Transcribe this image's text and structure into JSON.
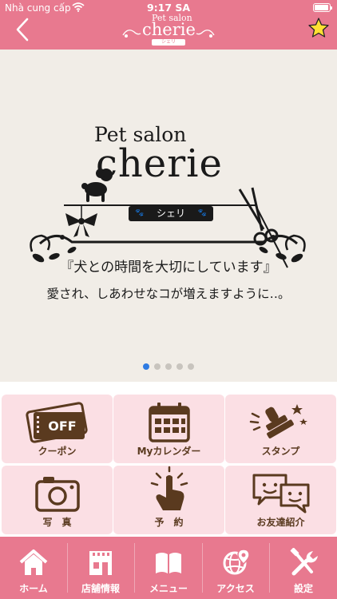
{
  "status_bar": {
    "carrier": "Nhà cung cấp",
    "time": "9:17 SA",
    "battery_level": 0.95
  },
  "header": {
    "back_icon": "chevron-left-icon",
    "logo_line1": "Pet salon",
    "logo_line2": "cherie",
    "logo_line3": "シェリ",
    "favorite_icon": "star-icon",
    "star_color": "#ffe033"
  },
  "hero": {
    "logo_pet": "Pet salon",
    "logo_cherie": "cherie",
    "logo_sheri": "シェリ",
    "tagline": "『犬との時間を大切にしています』",
    "subtagline": "愛され、しあわせなコが増えますように‥。",
    "slide_count": 5,
    "active_slide": 1
  },
  "menu": [
    {
      "label": "クーポン",
      "icon": "coupon-off-icon"
    },
    {
      "label": "Myカレンダー",
      "icon": "calendar-icon"
    },
    {
      "label": "スタンプ",
      "icon": "stamp-icon"
    },
    {
      "label": "写　真",
      "icon": "camera-icon"
    },
    {
      "label": "予　約",
      "icon": "tap-hand-icon"
    },
    {
      "label": "お友達紹介",
      "icon": "chat-faces-icon"
    }
  ],
  "coupon_icon_text": "OFF",
  "tabbar": [
    {
      "label": "ホーム",
      "icon": "home-icon"
    },
    {
      "label": "店舗情報",
      "icon": "store-icon"
    },
    {
      "label": "メニュー",
      "icon": "book-icon"
    },
    {
      "label": "アクセス",
      "icon": "globe-pin-icon"
    },
    {
      "label": "設定",
      "icon": "tools-icon"
    }
  ],
  "colors": {
    "brand_pink": "#e8798f",
    "tile_pink": "#fbdfe4",
    "icon_brown": "#5a3a1f",
    "hero_bg": "#f1ede7",
    "active_dot": "#2f7be2"
  }
}
